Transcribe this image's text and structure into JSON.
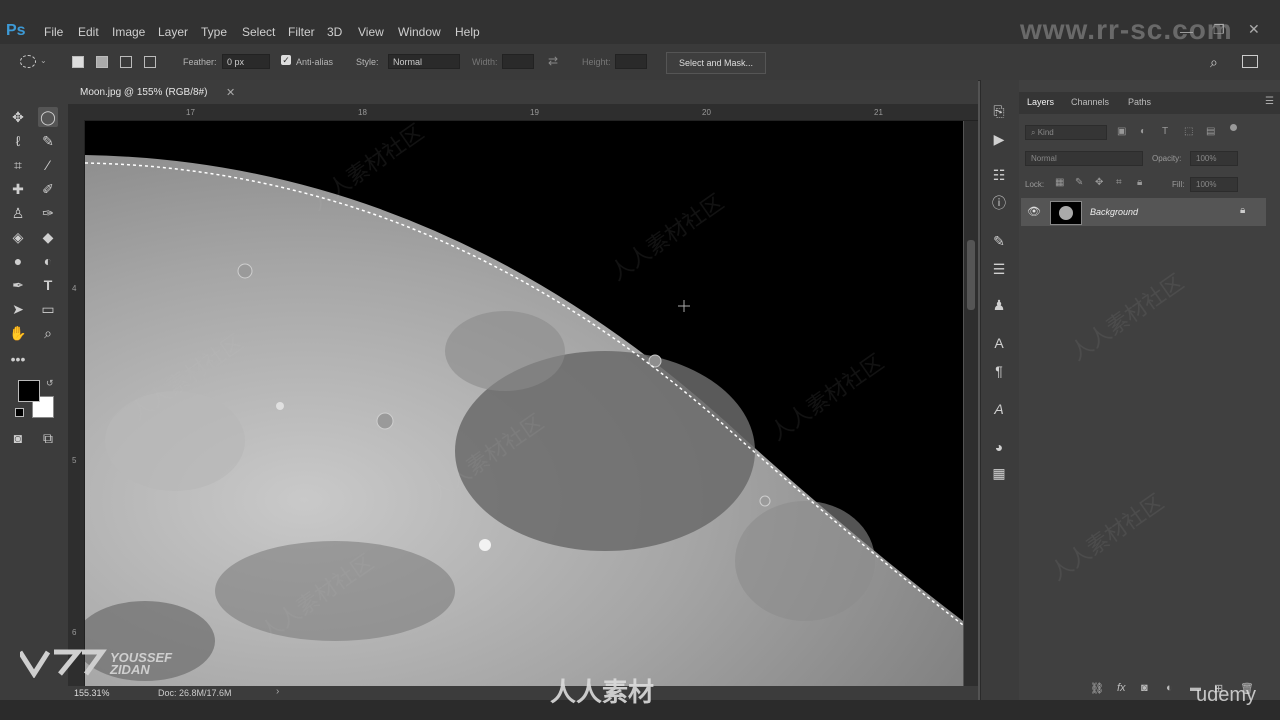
{
  "app": {
    "logo": "Ps"
  },
  "menu": [
    "File",
    "Edit",
    "Image",
    "Layer",
    "Type",
    "Select",
    "Filter",
    "3D",
    "View",
    "Window",
    "Help"
  ],
  "options": {
    "feather_label": "Feather:",
    "feather_value": "0 px",
    "antialias_label": "Anti-alias",
    "antialias_checked": true,
    "style_label": "Style:",
    "style_value": "Normal",
    "width_label": "Width:",
    "height_label": "Height:",
    "select_mask": "Select and Mask..."
  },
  "document": {
    "tab_title": "Moon.jpg @ 155% (RGB/8#)",
    "ruler_top": [
      "17",
      "18",
      "19",
      "20",
      "21"
    ],
    "ruler_left": [
      "4",
      "5",
      "6"
    ],
    "zoom": "155.31%",
    "doc_size": "Doc: 26.8M/17.6M"
  },
  "panel": {
    "tabs": [
      "Layers",
      "Channels",
      "Paths"
    ],
    "active_tab": "Layers",
    "kind_label": "Kind",
    "blend_mode": "Normal",
    "opacity_label": "Opacity:",
    "opacity_value": "100%",
    "lock_label": "Lock:",
    "fill_label": "Fill:",
    "fill_value": "100%",
    "layers": [
      {
        "name": "Background",
        "visible": true,
        "locked": true
      }
    ]
  },
  "overlay": {
    "watermark_url": "www.rr-sc.com",
    "instructor_first": "YOUSSEF",
    "instructor_last": "ZIDAN",
    "brand": "人人素材",
    "udemy": "udemy",
    "wm_text": "人人素材社区"
  },
  "colors": {
    "ps_blue": "#3d9ad6",
    "foreground": "#000000",
    "background": "#ffffff"
  }
}
